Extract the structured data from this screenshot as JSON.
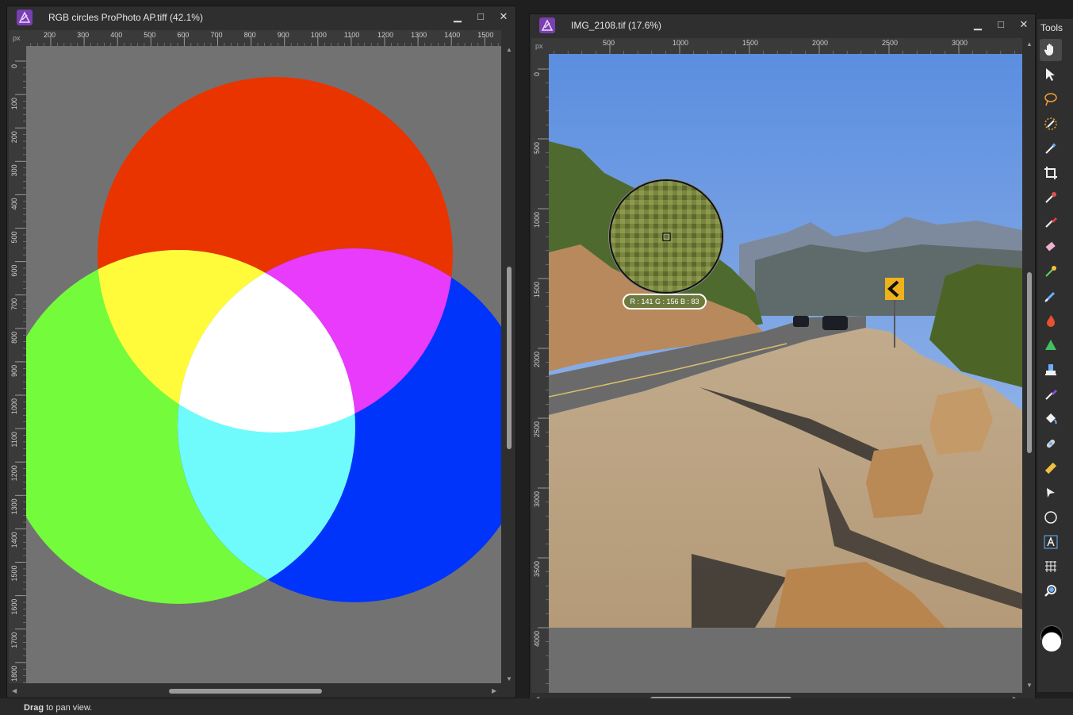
{
  "left_window": {
    "title": "RGB circles ProPhoto AP.tiff (42.1%)",
    "ruler_unit": "px",
    "h_ticks": [
      "200",
      "300",
      "400",
      "500",
      "600",
      "700",
      "800",
      "900",
      "1000",
      "1100",
      "1200",
      "1300",
      "1400",
      "1500"
    ],
    "v_ticks": [
      "0",
      "100",
      "200",
      "300",
      "400",
      "500",
      "600",
      "700",
      "800",
      "900",
      "1000",
      "1100",
      "1200",
      "1300",
      "1400",
      "1500",
      "1600",
      "1700",
      "1800"
    ],
    "colors": {
      "red": "#e93400",
      "green": "#74fb3c",
      "blue": "#0034fb",
      "yellow": "#fffb3a",
      "magenta": "#e93bfb",
      "cyan": "#6ffbfb",
      "white": "#ffffff",
      "background": "#727272"
    }
  },
  "right_window": {
    "title": "IMG_2108.tif (17.6%)",
    "ruler_unit": "px",
    "h_ticks": [
      "500",
      "1000",
      "1500",
      "2000",
      "2500",
      "3000"
    ],
    "v_ticks": [
      "0",
      "500",
      "1000",
      "1500",
      "2000",
      "2500",
      "3000",
      "3500",
      "4000"
    ],
    "readout": "R : 141 G : 156 B : 83"
  },
  "window_buttons": {
    "minimize": "▁",
    "maximize": "□",
    "close": "✕"
  },
  "tools_panel": {
    "title": "Tools",
    "items": [
      "hand-tool",
      "move-tool",
      "freehand-selection-tool",
      "selection-brush-tool",
      "flood-select-tool",
      "crop-tool",
      "color-picker-tool",
      "paint-brush-tool",
      "erase-brush-tool",
      "dodge-brush-tool",
      "smudge-brush-tool",
      "burn-brush-tool",
      "sharpen-brush-tool",
      "clone-brush-tool",
      "inpainting-brush-tool",
      "fill-tool",
      "blemish-tool",
      "measure-tool",
      "node-tool",
      "ellipse-tool",
      "text-tool",
      "mesh-warp-tool",
      "zoom-tool"
    ],
    "primary_color": "#000000",
    "secondary_color": "#ffffff"
  },
  "status": {
    "bold": "Drag",
    "text": " to pan view."
  }
}
